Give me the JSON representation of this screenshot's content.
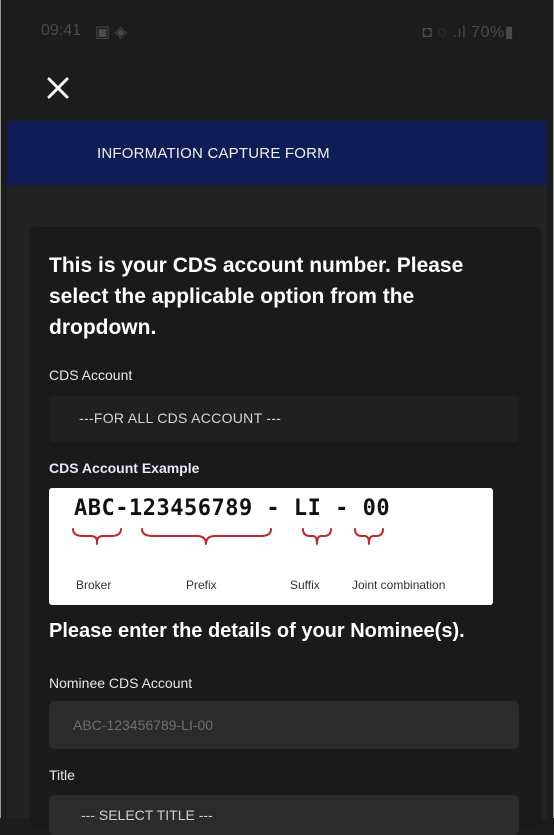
{
  "status_bar": {
    "time": "09:41",
    "left_icons": "▣ ◈",
    "right_text": "◘ ◌ .ıl 70%▮"
  },
  "header": {
    "title": "INFORMATION CAPTURE FORM"
  },
  "form": {
    "intro": "This is your CDS account number. Please select the applicable option from the dropdown.",
    "cds_account_label": "CDS Account",
    "cds_account_value": "---FOR ALL CDS ACCOUNT ---",
    "example_label": "CDS Account Example",
    "example": {
      "code": "ABC-123456789 - LI - 00",
      "labels": [
        "Broker",
        "Prefix",
        "Suffix",
        "Joint combination"
      ]
    },
    "nominee_heading": "Please enter the details of your Nominee(s).",
    "nominee_cds_label": "Nominee CDS Account",
    "nominee_cds_placeholder": "ABC-123456789-LI-00",
    "title_label": "Title",
    "title_value": "--- SELECT TITLE ---"
  },
  "colors": {
    "header_bg": "#0f1d57",
    "page_bg": "#1c1c1d",
    "card_bg": "#1a1a1b",
    "bracket": "#c0262c"
  },
  "icons": {
    "close": "close-icon"
  }
}
